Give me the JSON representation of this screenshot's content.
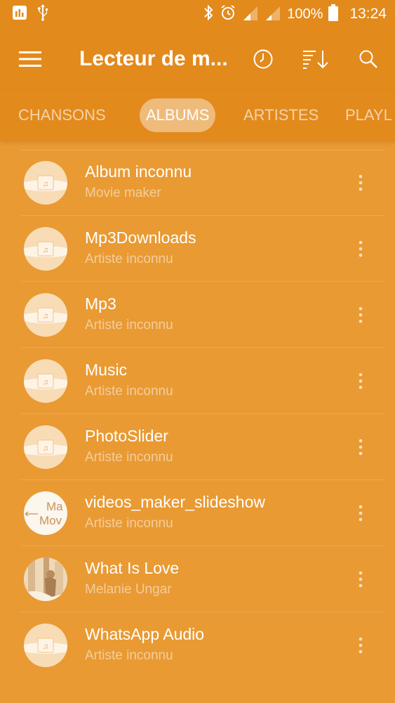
{
  "status_bar": {
    "battery_percent": "100%",
    "time": "13:24",
    "icons": [
      "equalizer-app-icon",
      "usb-icon",
      "bluetooth-icon",
      "alarm-icon",
      "signal-icon",
      "signal-icon",
      "battery-icon"
    ]
  },
  "toolbar": {
    "title": "Lecteur de m...",
    "icons": [
      "menu-icon",
      "history-icon",
      "sort-icon",
      "search-icon"
    ]
  },
  "tabs": [
    {
      "label": "CHANSONS",
      "active": false
    },
    {
      "label": "ALBUMS",
      "active": true
    },
    {
      "label": "ARTISTES",
      "active": false
    },
    {
      "label": "PLAYL",
      "active": false
    }
  ],
  "albums": [
    {
      "title": "Album inconnu",
      "artist": "Movie maker",
      "art": "default-album-art"
    },
    {
      "title": "Mp3Downloads",
      "artist": "Artiste inconnu",
      "art": "default-album-art"
    },
    {
      "title": "Mp3",
      "artist": "Artiste inconnu",
      "art": "default-album-art"
    },
    {
      "title": "Music",
      "artist": "Artiste inconnu",
      "art": "default-album-art"
    },
    {
      "title": "PhotoSlider",
      "artist": "Artiste inconnu",
      "art": "default-album-art"
    },
    {
      "title": "videos_maker_slideshow",
      "artist": "Artiste inconnu",
      "art": "text-thumbnail",
      "thumb_text": [
        "Ma",
        "Mov"
      ]
    },
    {
      "title": "What Is Love",
      "artist": "Melanie Ungar",
      "art": "photo-thumbnail"
    },
    {
      "title": "WhatsApp Audio",
      "artist": "Artiste inconnu",
      "art": "default-album-art"
    }
  ],
  "colors": {
    "background": "#E99A33",
    "header": "#E38A1C",
    "text": "#FFFFFF"
  }
}
